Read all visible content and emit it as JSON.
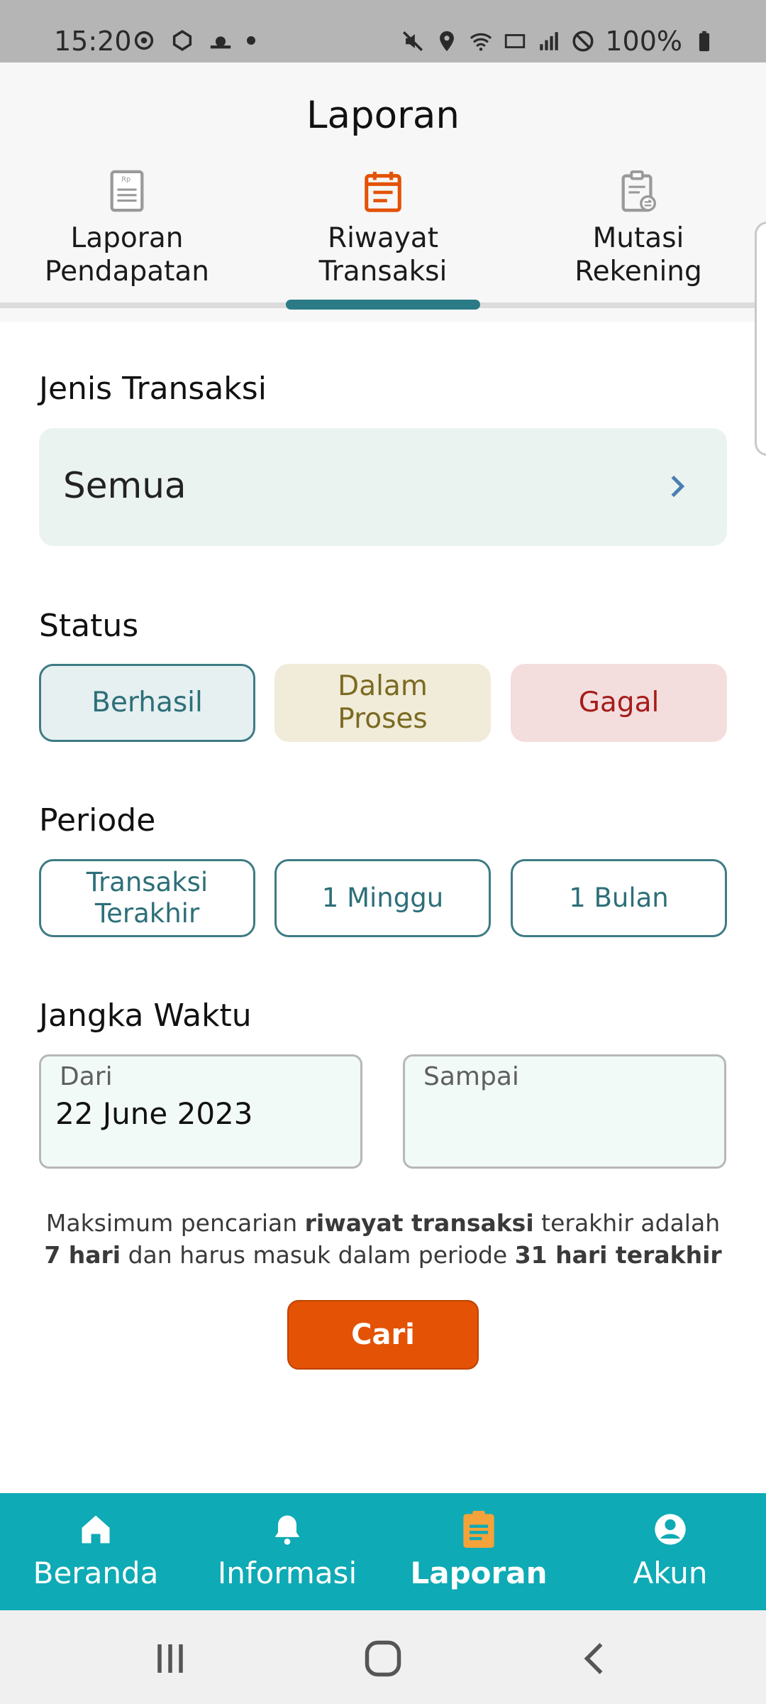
{
  "status_bar": {
    "time": "15:20",
    "battery": "100%",
    "icons": [
      "settings-icon",
      "cube-icon",
      "weather-icon",
      "dot-icon",
      "mute-icon",
      "location-icon",
      "wifi-icon",
      "lte-icon",
      "signal-icon",
      "block-icon",
      "battery-icon"
    ]
  },
  "header": {
    "title": "Laporan",
    "tabs": [
      {
        "label": "Laporan\nPendapatan",
        "icon": "receipt-icon",
        "active": false
      },
      {
        "label": "Riwayat\nTransaksi",
        "icon": "calendar-list-icon",
        "active": true
      },
      {
        "label": "Mutasi\nRekening",
        "icon": "clipboard-transfer-icon",
        "active": false
      }
    ]
  },
  "form": {
    "jenis_label": "Jenis Transaksi",
    "jenis_value": "Semua",
    "status_label": "Status",
    "status_options": [
      {
        "label": "Berhasil",
        "selected": true
      },
      {
        "label": "Dalam\nProses",
        "selected": false
      },
      {
        "label": "Gagal",
        "selected": false
      }
    ],
    "periode_label": "Periode",
    "periode_options": [
      {
        "label": "Transaksi\nTerakhir"
      },
      {
        "label": "1 Minggu"
      },
      {
        "label": "1 Bulan"
      }
    ],
    "jangka_label": "Jangka Waktu",
    "from_label": "Dari",
    "from_value": "22 June 2023",
    "to_label": "Sampai",
    "to_value": "",
    "note_parts": [
      "Maksimum pencarian ",
      "riwayat transaksi",
      " terakhir adalah",
      "7 hari",
      " dan harus masuk dalam periode ",
      "31 hari terakhir"
    ],
    "search_button": "Cari"
  },
  "bottom_nav": [
    {
      "label": "Beranda",
      "icon": "home-icon",
      "active": false
    },
    {
      "label": "Informasi",
      "icon": "bell-icon",
      "active": false
    },
    {
      "label": "Laporan",
      "icon": "clipboard-icon",
      "active": true
    },
    {
      "label": "Akun",
      "icon": "account-icon",
      "active": false
    }
  ],
  "colors": {
    "accent_teal": "#0eaab5",
    "active_orange": "#e35205",
    "nav_active_icon": "#f4a23a"
  }
}
